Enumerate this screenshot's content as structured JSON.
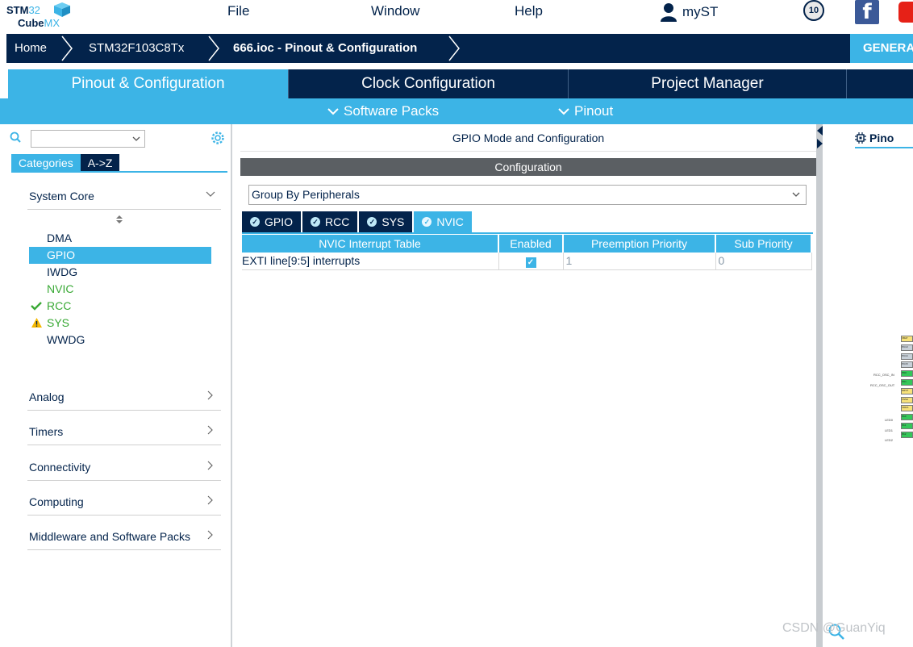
{
  "app": {
    "logo_line1_bold": "STM",
    "logo_line1_thin": "32",
    "logo_line2_bold": "Cube",
    "logo_line2_thin": "MX"
  },
  "menu": {
    "file": "File",
    "window": "Window",
    "help": "Help",
    "myst": "myST",
    "anniversary": "10"
  },
  "breadcrumb": {
    "home": "Home",
    "mcu": "STM32F103C8Tx",
    "project": "666.ioc - Pinout & Configuration",
    "generate": "GENERA"
  },
  "tabs": {
    "pinout": "Pinout & Configuration",
    "clock": "Clock Configuration",
    "project": "Project Manager"
  },
  "subbar": {
    "software_packs": "Software Packs",
    "pinout": "Pinout"
  },
  "left": {
    "cat_tab_categories": "Categories",
    "cat_tab_az": "A->Z",
    "system_core": "System Core",
    "peripherals": [
      {
        "label": "DMA",
        "status": "none"
      },
      {
        "label": "GPIO",
        "status": "selected"
      },
      {
        "label": "IWDG",
        "status": "none"
      },
      {
        "label": "NVIC",
        "status": "configured"
      },
      {
        "label": "RCC",
        "status": "ok"
      },
      {
        "label": "SYS",
        "status": "warning"
      },
      {
        "label": "WWDG",
        "status": "none"
      }
    ],
    "groups": [
      "Analog",
      "Timers",
      "Connectivity",
      "Computing",
      "Middleware and Software Packs"
    ]
  },
  "middle": {
    "header": "GPIO Mode and Configuration",
    "configuration": "Configuration",
    "group_by": "Group By Peripherals",
    "periph_tabs": [
      "GPIO",
      "RCC",
      "SYS",
      "NVIC"
    ],
    "active_tab": "NVIC",
    "table": {
      "headers": [
        "NVIC Interrupt Table",
        "Enabled",
        "Preemption Priority",
        "Sub Priority"
      ],
      "rows": [
        {
          "name": "EXTI line[9:5] interrupts",
          "enabled": true,
          "preemption": "1",
          "sub": "0"
        }
      ]
    }
  },
  "right": {
    "pinout_tab": "Pino",
    "pins": [
      "VBAT",
      "PC13",
      "PC14",
      "PC15",
      "PD0",
      "PD1",
      "NRST",
      "VSSA",
      "VDDA",
      "PA0",
      "PA1",
      "PA2"
    ],
    "pin_labels": [
      "RCC_OSC_IN",
      "RCC_OSC_OUT",
      "LED0",
      "LED1",
      "LED2"
    ]
  },
  "watermark": "CSDN @GuanYiq",
  "colors": {
    "navy": "#03234b",
    "accent": "#3cb4e6",
    "ok": "#39a935",
    "warn": "#f5b800",
    "pin_green": "#34c759",
    "pin_yellow": "#f7e27a"
  }
}
